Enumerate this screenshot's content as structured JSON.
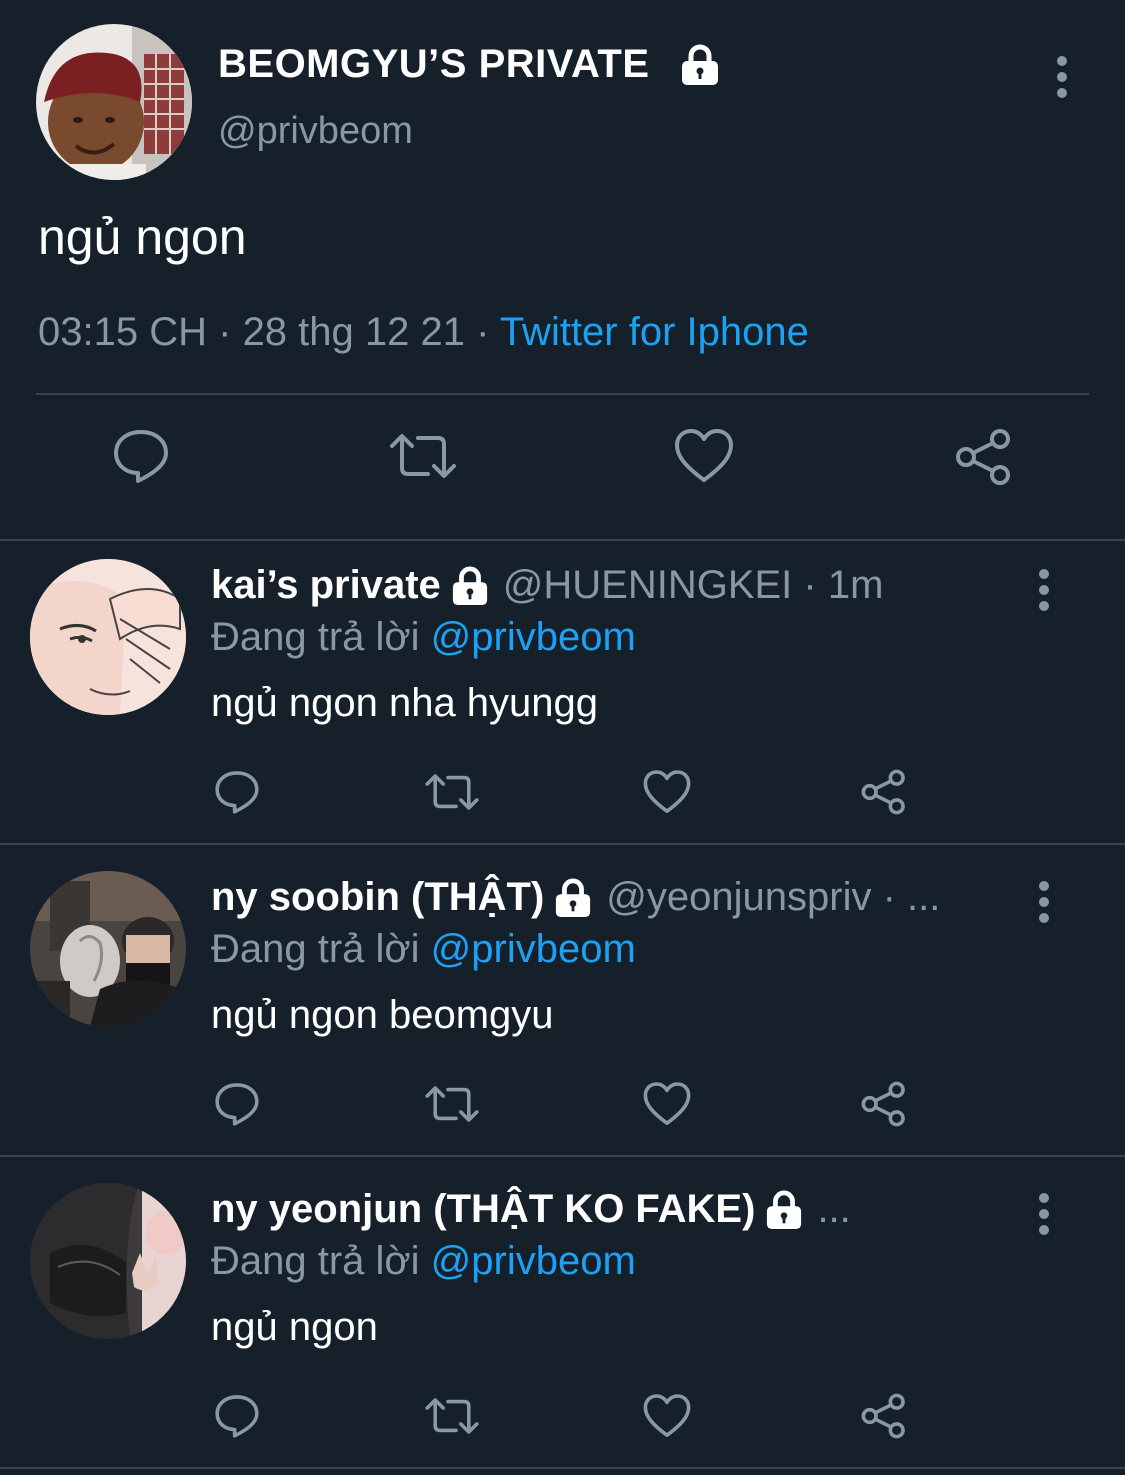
{
  "main_tweet": {
    "display_name": "BEOMGYU’S PRIVATE",
    "handle": "@privbeom",
    "text": "ngủ ngon",
    "time": "03:15 CH",
    "date": "28 thg 12 21",
    "separator": "·",
    "client": "Twitter for Iphone",
    "protected_icon": "lock-icon",
    "more_icon": "more-vertical-icon",
    "actions": [
      "reply-icon",
      "retweet-icon",
      "like-icon",
      "share-icon"
    ]
  },
  "replies": [
    {
      "display_name": "kai’s private",
      "handle": "@HUENINGKEI · 1m",
      "replying_prefix": "Đang trả lời",
      "replying_to": "@privbeom",
      "text": "ngủ ngon nha hyungg"
    },
    {
      "display_name": "ny soobin (THẬT)",
      "handle": "@yeonjunspriv · ...",
      "replying_prefix": "Đang trả lời",
      "replying_to": "@privbeom",
      "text": "ngủ ngon beomgyu"
    },
    {
      "display_name": "ny yeonjun (THẬT KO FAKE)",
      "handle": "...",
      "replying_prefix": "Đang trả lời",
      "replying_to": "@privbeom",
      "text": "ngủ ngon"
    }
  ],
  "colors": {
    "background": "#15202b",
    "secondary_text": "#8899a6",
    "link": "#1da1f2",
    "divider": "#38444d"
  }
}
